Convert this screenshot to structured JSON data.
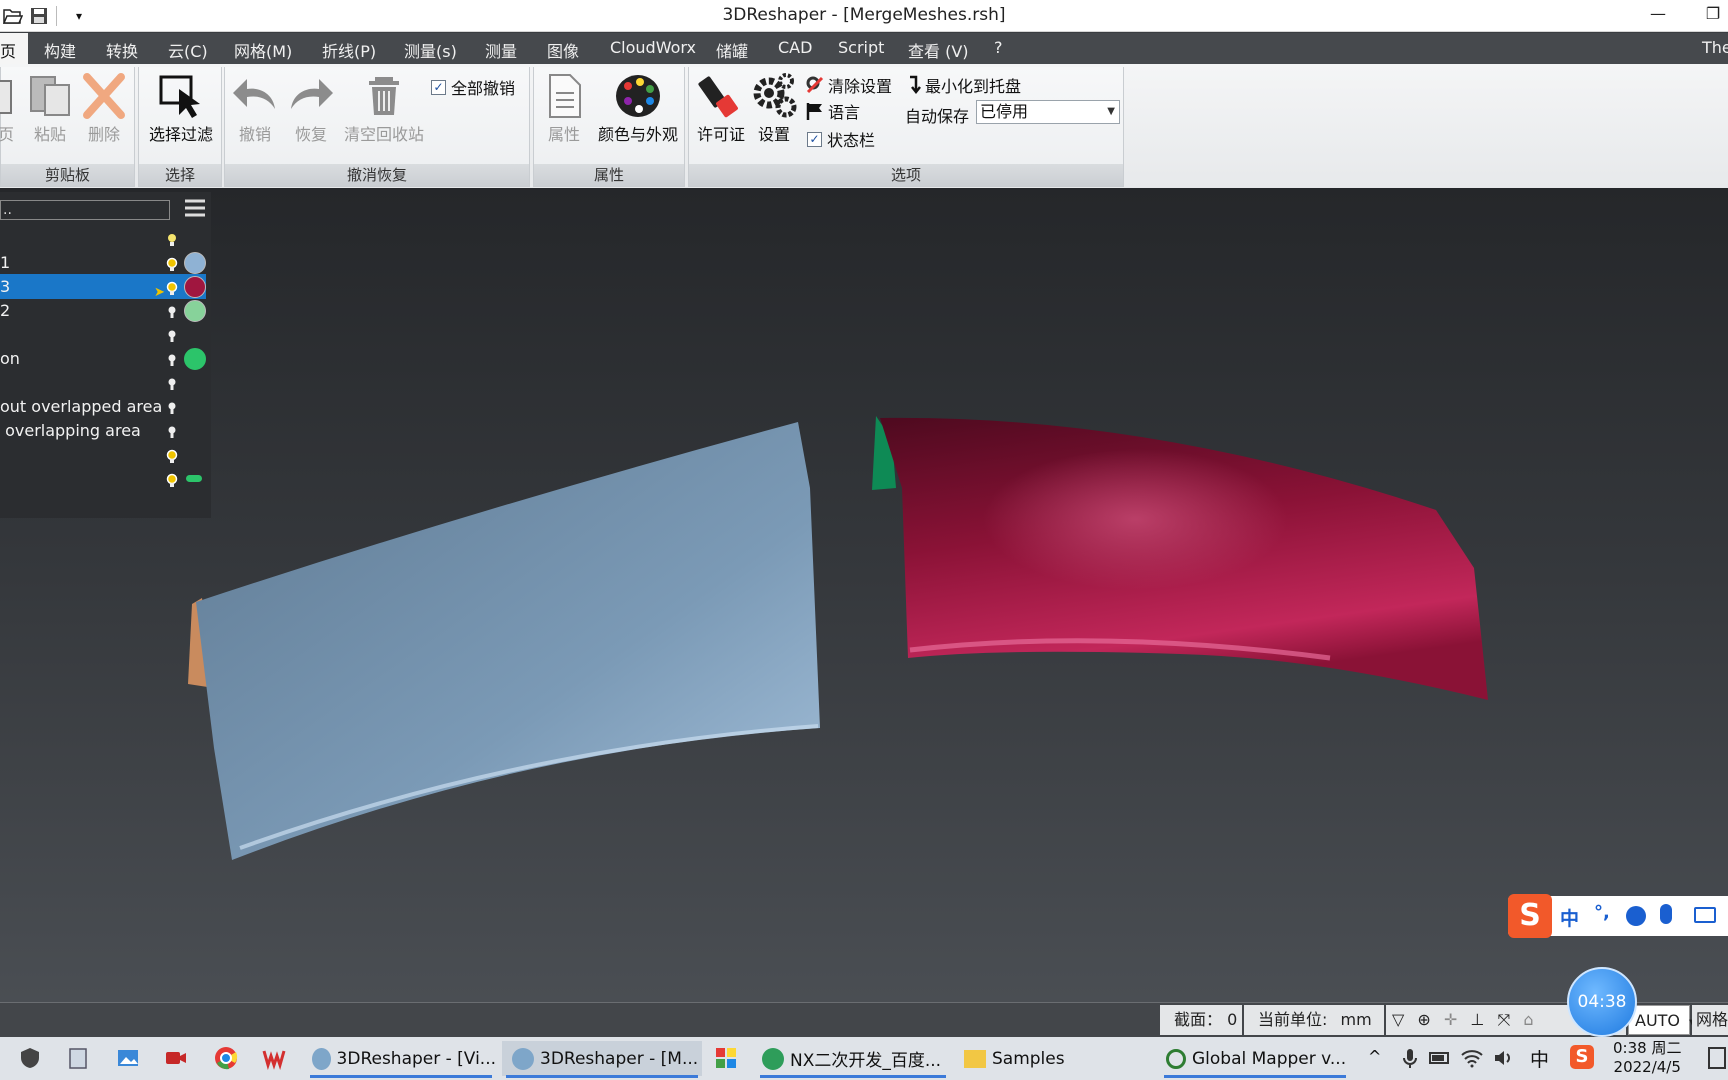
{
  "window": {
    "title": "3DReshaper - [MergeMeshes.rsh]"
  },
  "menu": {
    "items": [
      "页",
      "构建",
      "转换",
      "云(C)",
      "网格(M)",
      "折线(P)",
      "测量(s)",
      "测量",
      "图像",
      "CloudWorx",
      "储罐",
      "CAD",
      "Script",
      "查看 (V)",
      "?"
    ],
    "right_text": "The"
  },
  "ribbon": {
    "clipboard": {
      "copy": "页",
      "paste": "粘贴",
      "delete": "删除",
      "group": "剪贴板"
    },
    "select": {
      "filter": "选择过滤",
      "group": "选择"
    },
    "undo": {
      "undo": "撤销",
      "redo": "恢复",
      "empty_bin": "清空回收站",
      "undo_all": "全部撤销",
      "group": "撤消恢复"
    },
    "props": {
      "properties": "属性",
      "color": "颜色与外观",
      "group": "属性"
    },
    "options": {
      "license": "许可证",
      "settings": "设置",
      "clear_settings": "清除设置",
      "language": "语言",
      "statusbar": "状态栏",
      "minimize_tray": "最小化到托盘",
      "autosave_label": "自动保存",
      "autosave_value": "已停用",
      "group": "选项"
    }
  },
  "tree": {
    "search_value": "..",
    "rows": [
      {
        "label": "",
        "color": ""
      },
      {
        "label": "1",
        "color": "#8fb2d4"
      },
      {
        "label": "3",
        "color": "#a0163f"
      },
      {
        "label": "2",
        "color": "#87d29a"
      },
      {
        "label": "",
        "color": ""
      },
      {
        "label": "on",
        "color": "#2cc46a"
      },
      {
        "label": "",
        "color": ""
      },
      {
        "label": "out overlapped area",
        "color": ""
      },
      {
        "label": " overlapping area",
        "color": ""
      },
      {
        "label": "",
        "color": ""
      },
      {
        "label": "",
        "color": ""
      }
    ]
  },
  "status": {
    "section_label": "截面：",
    "section_value": "0",
    "unit_label": "当前单位:",
    "unit_value": "mm",
    "mode": "AUTO",
    "grid": "网格"
  },
  "timer": "04:38",
  "taskbar": {
    "apps": [
      "3DReshaper - [Vi...",
      "3DReshaper - [M...",
      "NX二次开发_百度...",
      "Samples",
      "Global Mapper v..."
    ],
    "ime": "中",
    "time": "0:38 周二",
    "date": "2022/4/5"
  },
  "ime_bar": {
    "lang": "中",
    "punct": "°,"
  }
}
